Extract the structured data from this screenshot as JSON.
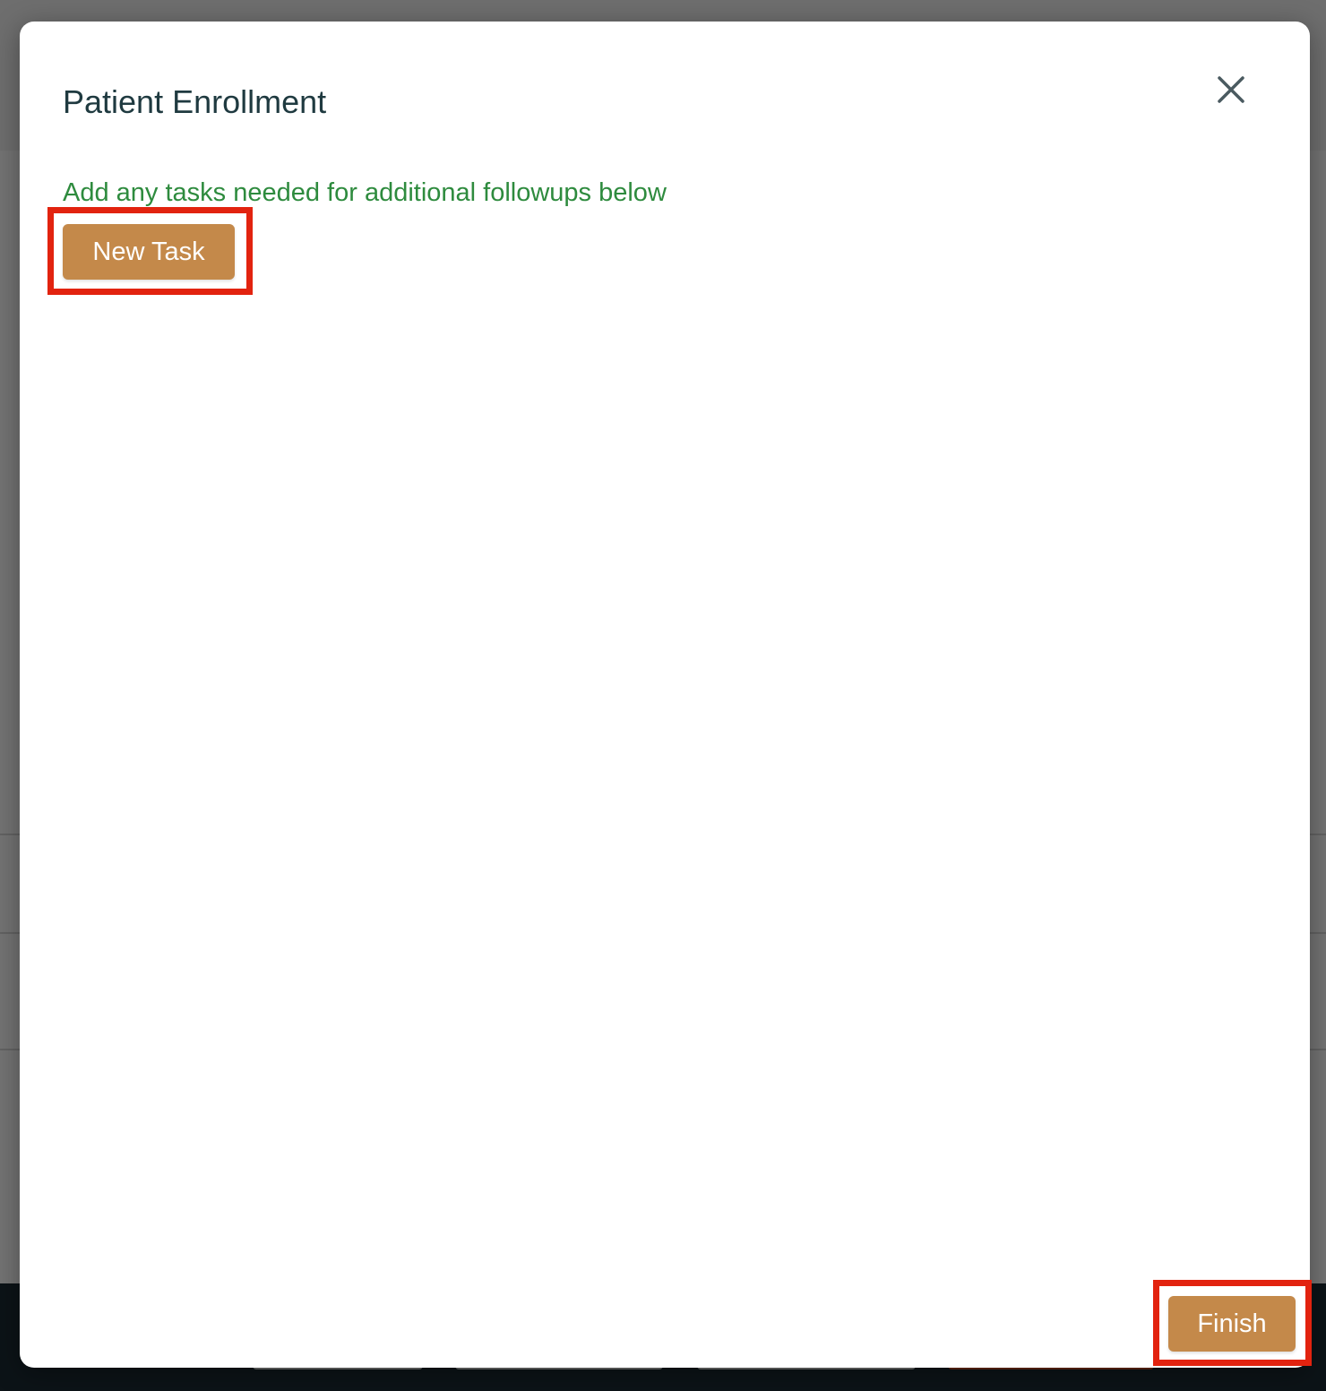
{
  "modal": {
    "title": "Patient Enrollment",
    "subtitle": "Add any tasks needed for additional followups below",
    "close_icon": "close-icon",
    "new_task_label": "New Task",
    "finish_label": "Finish"
  },
  "colors": {
    "button_brown": "#c4894a",
    "subtitle_green": "#2e8b3e",
    "title_dark": "#1f3a40",
    "highlight_red": "#e2230f",
    "footer_dark": "#1c2a33"
  }
}
